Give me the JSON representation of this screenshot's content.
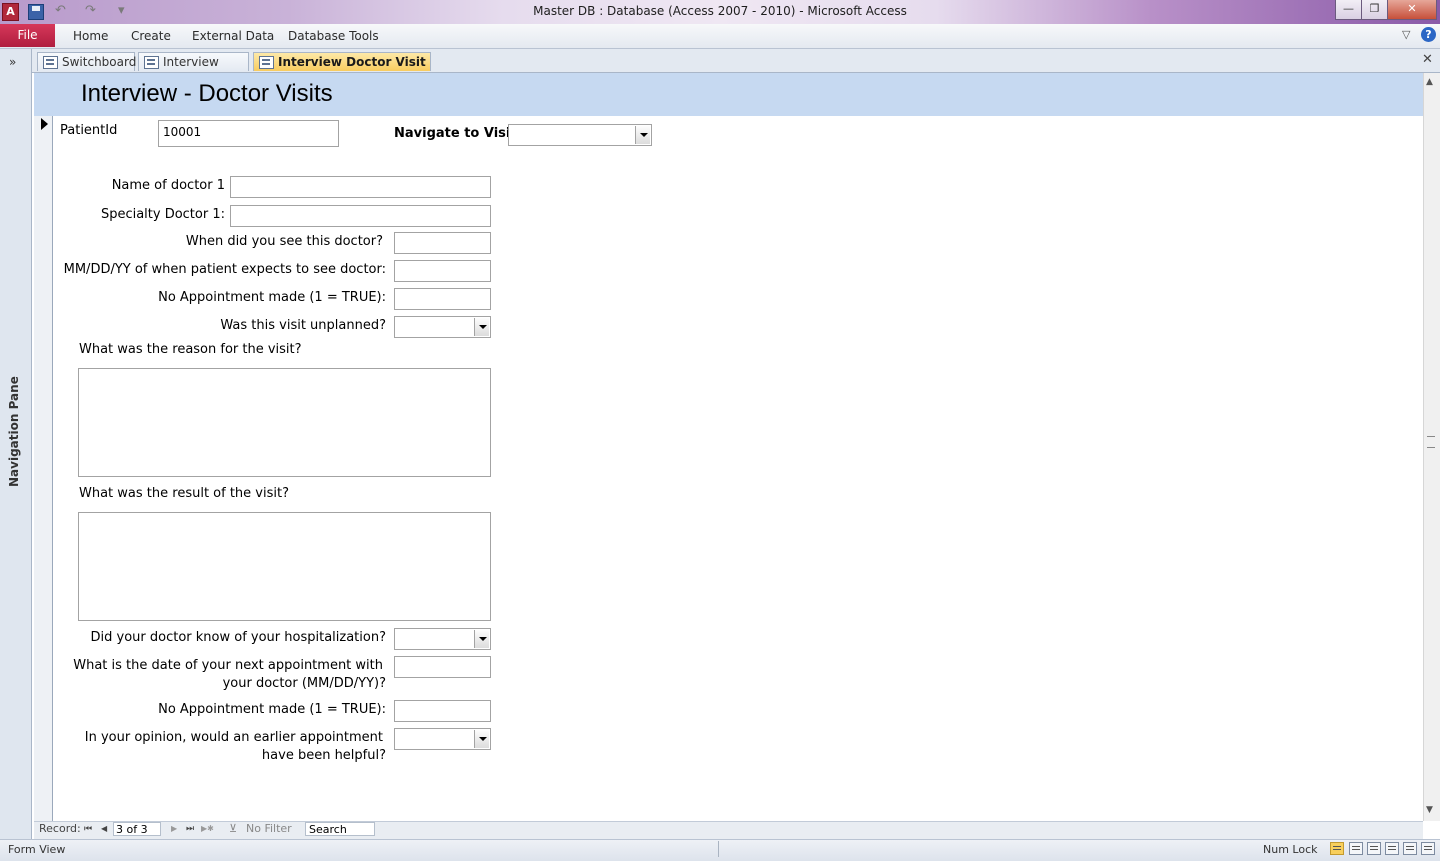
{
  "window": {
    "title": "Master DB : Database (Access 2007 - 2010)  -  Microsoft Access",
    "app_icon_letter": "A",
    "controls": {
      "minimize": "—",
      "restore": "❐",
      "close": "✕"
    }
  },
  "quick_access": {
    "undo": "↶",
    "redo": "↷",
    "customize": "▾"
  },
  "ribbon": {
    "file_tab": "File",
    "tabs": [
      "Home",
      "Create",
      "External Data",
      "Database Tools"
    ],
    "collapse_glyph": "▽",
    "help_glyph": "?"
  },
  "nav_pane": {
    "toggle": "»",
    "label": "Navigation Pane"
  },
  "doc_tabs": {
    "items": [
      "Switchboard",
      "Interview Form",
      "Interview Doctor Visit Form"
    ],
    "active_index": 2,
    "close_glyph": "✕"
  },
  "form": {
    "title": "Interview - Doctor Visits",
    "patient_id": {
      "label": "PatientId",
      "value": "10001"
    },
    "navigate": {
      "label": "Navigate to Visit:",
      "value": ""
    },
    "fields": {
      "doctor_name": {
        "label": "Name of doctor 1",
        "value": ""
      },
      "specialty": {
        "label": "Specialty Doctor 1:",
        "value": ""
      },
      "when_seen": {
        "label": "When did you see this doctor?",
        "value": ""
      },
      "expects_date": {
        "label": "MM/DD/YY of when patient expects to see doctor:",
        "value": ""
      },
      "no_appt_1": {
        "label": "No Appointment made (1 = TRUE):",
        "value": ""
      },
      "unplanned": {
        "label": "Was this visit unplanned?",
        "value": ""
      },
      "reason": {
        "label": "What was the reason for the visit?",
        "value": ""
      },
      "result": {
        "label": "What was the result of the visit?",
        "value": ""
      },
      "doctor_knew": {
        "label": "Did your doctor know of your hospitalization?",
        "value": ""
      },
      "next_appt_line1": "What is the date of your next appointment with",
      "next_appt_line2": "your doctor (MM/DD/YY)?",
      "next_appt_value": "",
      "no_appt_2": {
        "label": "No Appointment made (1 = TRUE):",
        "value": ""
      },
      "earlier_line1": "In your opinion, would an earlier appointment",
      "earlier_line2": "have been helpful?",
      "earlier_value": ""
    }
  },
  "record_nav": {
    "label": "Record:",
    "first": "⏮",
    "prev": "◀",
    "position": "3 of 3",
    "next": "▶",
    "last": "⏭",
    "new": "▶✱",
    "filter": "No Filter",
    "search": "Search"
  },
  "status_bar": {
    "mode": "Form View",
    "num_lock": "Num Lock"
  }
}
